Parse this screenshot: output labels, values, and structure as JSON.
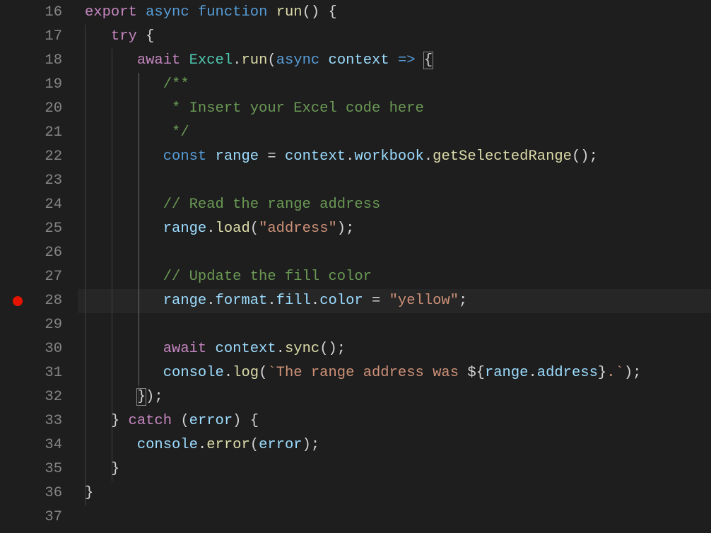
{
  "editor": {
    "firstLineNumber": 16,
    "breakpointLine": 28,
    "highlightLine": 28,
    "indentGuides": {
      "unit": 38,
      "offset": 10,
      "perLine": {
        "16": 0,
        "17": 1,
        "18": 2,
        "19": 3,
        "20": 3,
        "21": 3,
        "22": 3,
        "23": 3,
        "24": 3,
        "25": 3,
        "26": 3,
        "27": 3,
        "28": 3,
        "29": 3,
        "30": 3,
        "31": 3,
        "32": 3,
        "33": 2,
        "34": 2,
        "35": 2,
        "36": 1,
        "37": 0
      },
      "activeLevels": {
        "28": 3,
        "19": 3,
        "20": 3,
        "21": 3,
        "22": 3,
        "23": 3,
        "24": 3,
        "25": 3,
        "26": 3,
        "27": 3,
        "29": 3,
        "30": 3,
        "31": 3
      }
    },
    "lines": [
      [
        {
          "cls": "tok-k_export",
          "t": "export"
        },
        {
          "cls": "tok-punc",
          "t": " "
        },
        {
          "cls": "tok-k_async",
          "t": "async"
        },
        {
          "cls": "tok-punc",
          "t": " "
        },
        {
          "cls": "tok-k_func",
          "t": "function"
        },
        {
          "cls": "tok-punc",
          "t": " "
        },
        {
          "cls": "tok-fn",
          "t": "run"
        },
        {
          "cls": "tok-punc",
          "t": "() {"
        }
      ],
      [
        {
          "cls": "tok-punc",
          "t": "  "
        },
        {
          "cls": "tok-k_try",
          "t": "try"
        },
        {
          "cls": "tok-punc",
          "t": " {"
        }
      ],
      [
        {
          "cls": "tok-punc",
          "t": "    "
        },
        {
          "cls": "tok-k_await",
          "t": "await"
        },
        {
          "cls": "tok-punc",
          "t": " "
        },
        {
          "cls": "tok-cls",
          "t": "Excel"
        },
        {
          "cls": "tok-punc",
          "t": "."
        },
        {
          "cls": "tok-fn",
          "t": "run"
        },
        {
          "cls": "tok-punc",
          "t": "("
        },
        {
          "cls": "tok-k_async",
          "t": "async"
        },
        {
          "cls": "tok-punc",
          "t": " "
        },
        {
          "cls": "tok-var",
          "t": "context"
        },
        {
          "cls": "tok-punc",
          "t": " "
        },
        {
          "cls": "tok-k_func",
          "t": "=>"
        },
        {
          "cls": "tok-punc",
          "t": " "
        },
        {
          "cls": "tok-brace-hl",
          "t": "{"
        }
      ],
      [
        {
          "cls": "tok-punc",
          "t": "      "
        },
        {
          "cls": "tok-cmt",
          "t": "/**"
        }
      ],
      [
        {
          "cls": "tok-punc",
          "t": "      "
        },
        {
          "cls": "tok-cmt",
          "t": " * Insert your Excel code here"
        }
      ],
      [
        {
          "cls": "tok-punc",
          "t": "      "
        },
        {
          "cls": "tok-cmt",
          "t": " */"
        }
      ],
      [
        {
          "cls": "tok-punc",
          "t": "      "
        },
        {
          "cls": "tok-k_const",
          "t": "const"
        },
        {
          "cls": "tok-punc",
          "t": " "
        },
        {
          "cls": "tok-var",
          "t": "range"
        },
        {
          "cls": "tok-punc",
          "t": " = "
        },
        {
          "cls": "tok-var",
          "t": "context"
        },
        {
          "cls": "tok-punc",
          "t": "."
        },
        {
          "cls": "tok-prop",
          "t": "workbook"
        },
        {
          "cls": "tok-punc",
          "t": "."
        },
        {
          "cls": "tok-fn",
          "t": "getSelectedRange"
        },
        {
          "cls": "tok-punc",
          "t": "();"
        }
      ],
      [
        {
          "cls": "tok-punc",
          "t": ""
        }
      ],
      [
        {
          "cls": "tok-punc",
          "t": "      "
        },
        {
          "cls": "tok-cmt",
          "t": "// Read the range address"
        }
      ],
      [
        {
          "cls": "tok-punc",
          "t": "      "
        },
        {
          "cls": "tok-var",
          "t": "range"
        },
        {
          "cls": "tok-punc",
          "t": "."
        },
        {
          "cls": "tok-fn",
          "t": "load"
        },
        {
          "cls": "tok-punc",
          "t": "("
        },
        {
          "cls": "tok-str",
          "t": "\"address\""
        },
        {
          "cls": "tok-punc",
          "t": ");"
        }
      ],
      [
        {
          "cls": "tok-punc",
          "t": ""
        }
      ],
      [
        {
          "cls": "tok-punc",
          "t": "      "
        },
        {
          "cls": "tok-cmt",
          "t": "// Update the fill color"
        }
      ],
      [
        {
          "cls": "tok-punc",
          "t": "      "
        },
        {
          "cls": "tok-var",
          "t": "range"
        },
        {
          "cls": "tok-punc",
          "t": "."
        },
        {
          "cls": "tok-prop",
          "t": "format"
        },
        {
          "cls": "tok-punc",
          "t": "."
        },
        {
          "cls": "tok-prop",
          "t": "fill"
        },
        {
          "cls": "tok-punc",
          "t": "."
        },
        {
          "cls": "tok-prop",
          "t": "color"
        },
        {
          "cls": "tok-punc",
          "t": " = "
        },
        {
          "cls": "tok-str",
          "t": "\"yellow\""
        },
        {
          "cls": "tok-punc",
          "t": ";"
        }
      ],
      [
        {
          "cls": "tok-punc",
          "t": ""
        }
      ],
      [
        {
          "cls": "tok-punc",
          "t": "      "
        },
        {
          "cls": "tok-k_await",
          "t": "await"
        },
        {
          "cls": "tok-punc",
          "t": " "
        },
        {
          "cls": "tok-var",
          "t": "context"
        },
        {
          "cls": "tok-punc",
          "t": "."
        },
        {
          "cls": "tok-fn",
          "t": "sync"
        },
        {
          "cls": "tok-punc",
          "t": "();"
        }
      ],
      [
        {
          "cls": "tok-punc",
          "t": "      "
        },
        {
          "cls": "tok-var",
          "t": "console"
        },
        {
          "cls": "tok-punc",
          "t": "."
        },
        {
          "cls": "tok-fn",
          "t": "log"
        },
        {
          "cls": "tok-punc",
          "t": "("
        },
        {
          "cls": "tok-tpl",
          "t": "`The range address was "
        },
        {
          "cls": "tok-punc",
          "t": "${"
        },
        {
          "cls": "tok-var",
          "t": "range"
        },
        {
          "cls": "tok-punc",
          "t": "."
        },
        {
          "cls": "tok-prop",
          "t": "address"
        },
        {
          "cls": "tok-punc",
          "t": "}"
        },
        {
          "cls": "tok-tpl",
          "t": ".`"
        },
        {
          "cls": "tok-punc",
          "t": ");"
        }
      ],
      [
        {
          "cls": "tok-punc",
          "t": "    "
        },
        {
          "cls": "tok-brace-hl",
          "t": "}"
        },
        {
          "cls": "tok-punc",
          "t": ");"
        }
      ],
      [
        {
          "cls": "tok-punc",
          "t": "  } "
        },
        {
          "cls": "tok-k_catch",
          "t": "catch"
        },
        {
          "cls": "tok-punc",
          "t": " ("
        },
        {
          "cls": "tok-var",
          "t": "error"
        },
        {
          "cls": "tok-punc",
          "t": ") {"
        }
      ],
      [
        {
          "cls": "tok-punc",
          "t": "    "
        },
        {
          "cls": "tok-var",
          "t": "console"
        },
        {
          "cls": "tok-punc",
          "t": "."
        },
        {
          "cls": "tok-fn",
          "t": "error"
        },
        {
          "cls": "tok-punc",
          "t": "("
        },
        {
          "cls": "tok-var",
          "t": "error"
        },
        {
          "cls": "tok-punc",
          "t": ");"
        }
      ],
      [
        {
          "cls": "tok-punc",
          "t": "  }"
        }
      ],
      [
        {
          "cls": "tok-punc",
          "t": "}"
        }
      ],
      [
        {
          "cls": "tok-punc",
          "t": ""
        }
      ]
    ]
  }
}
